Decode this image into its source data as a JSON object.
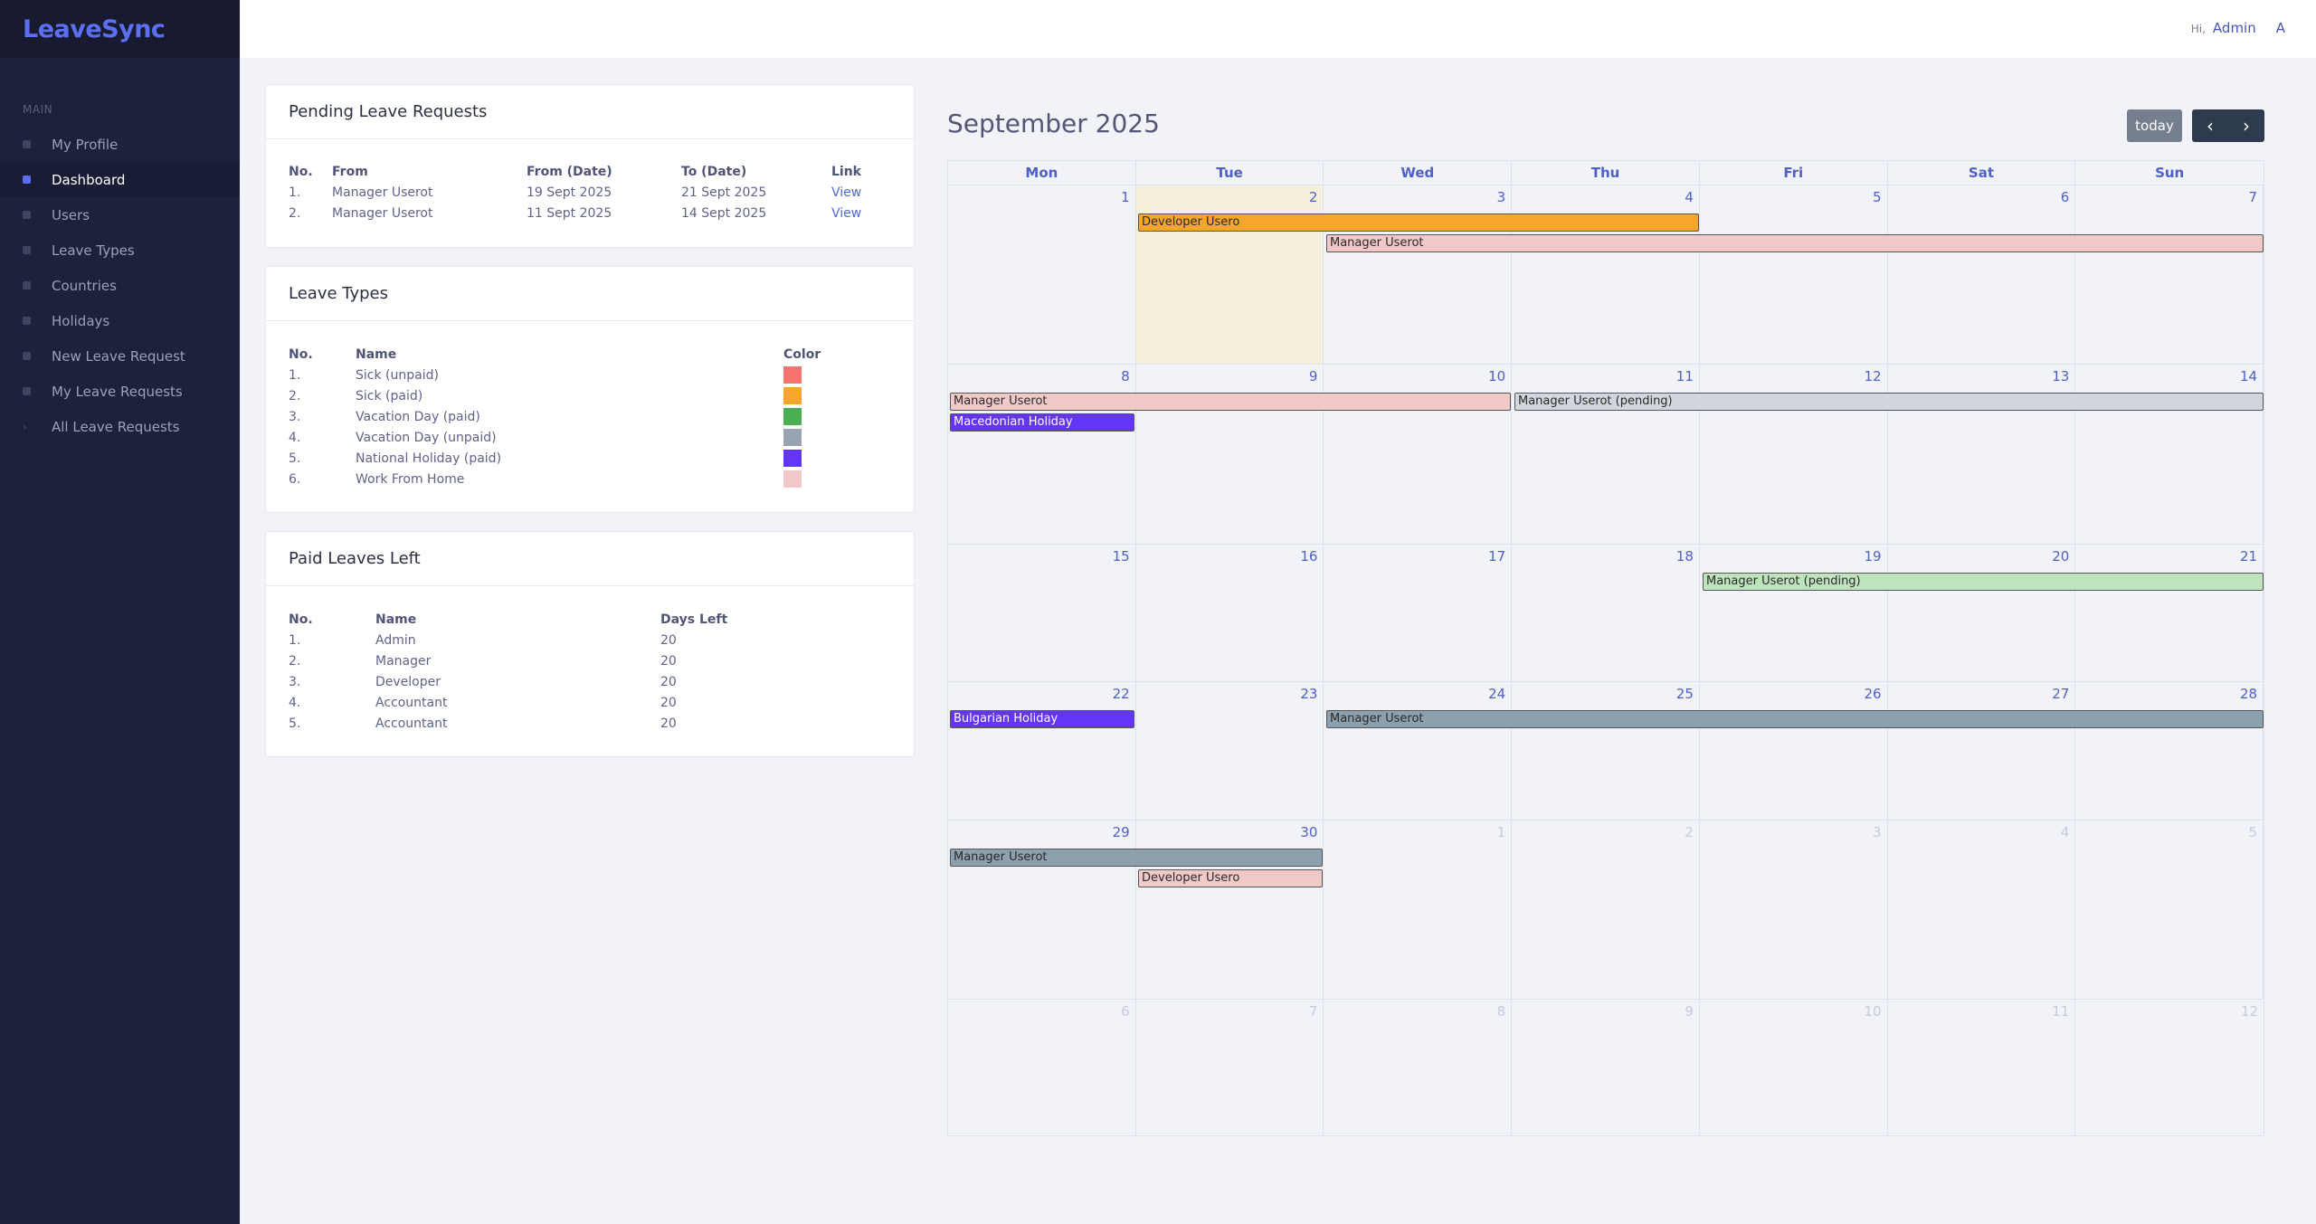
{
  "app": {
    "brand": "LeaveSync"
  },
  "header": {
    "greeting": "Hi,",
    "user_name": "Admin",
    "avatar_letter": "A"
  },
  "sidebar": {
    "section": "MAIN",
    "items": [
      {
        "label": "My Profile",
        "icon": "profile-icon"
      },
      {
        "label": "Dashboard",
        "icon": "dashboard-icon",
        "active": true
      },
      {
        "label": "Users",
        "icon": "users-icon"
      },
      {
        "label": "Leave Types",
        "icon": "leave-types-icon"
      },
      {
        "label": "Countries",
        "icon": "globe-icon"
      },
      {
        "label": "Holidays",
        "icon": "holiday-icon"
      },
      {
        "label": "New Leave Request",
        "icon": "add-icon"
      },
      {
        "label": "My Leave Requests",
        "icon": "document-icon"
      },
      {
        "label": "All Leave Requests",
        "icon": "chevron-right-icon"
      }
    ]
  },
  "pending": {
    "title": "Pending Leave Requests",
    "headers": {
      "no": "No.",
      "from": "From",
      "from_date": "From (Date)",
      "to_date": "To (Date)",
      "link": "Link"
    },
    "rows": [
      {
        "no": "1.",
        "from": "Manager Userot",
        "from_date": "19 Sept 2025",
        "to_date": "21 Sept 2025",
        "link": "View"
      },
      {
        "no": "2.",
        "from": "Manager Userot",
        "from_date": "11 Sept 2025",
        "to_date": "14 Sept 2025",
        "link": "View"
      }
    ]
  },
  "leave_types": {
    "title": "Leave Types",
    "headers": {
      "no": "No.",
      "name": "Name",
      "color": "Color"
    },
    "rows": [
      {
        "no": "1.",
        "name": "Sick (unpaid)",
        "color": "#f4736f"
      },
      {
        "no": "2.",
        "name": "Sick (paid)",
        "color": "#f6a72b"
      },
      {
        "no": "3.",
        "name": "Vacation Day (paid)",
        "color": "#4cae52"
      },
      {
        "no": "4.",
        "name": "Vacation Day (unpaid)",
        "color": "#9aa3b0"
      },
      {
        "no": "5.",
        "name": "National Holiday (paid)",
        "color": "#6335f6"
      },
      {
        "no": "6.",
        "name": "Work From Home",
        "color": "#f2c9c9"
      }
    ]
  },
  "paid_leaves": {
    "title": "Paid Leaves Left",
    "headers": {
      "no": "No.",
      "name": "Name",
      "days": "Days Left"
    },
    "rows": [
      {
        "no": "1.",
        "name": "Admin",
        "days": "20"
      },
      {
        "no": "2.",
        "name": "Manager",
        "days": "20"
      },
      {
        "no": "3.",
        "name": "Developer",
        "days": "20"
      },
      {
        "no": "4.",
        "name": "Accountant",
        "days": "20"
      },
      {
        "no": "5.",
        "name": "Accountant",
        "days": "20"
      }
    ]
  },
  "calendar": {
    "title": "September 2025",
    "today_label": "today",
    "prev_icon": "chevron-left-icon",
    "next_icon": "chevron-right-icon",
    "days_of_week": [
      "Mon",
      "Tue",
      "Wed",
      "Thu",
      "Fri",
      "Sat",
      "Sun"
    ],
    "weeks": [
      {
        "days": [
          "1",
          "2",
          "3",
          "4",
          "5",
          "6",
          "7"
        ],
        "other": [],
        "today": 1
      },
      {
        "days": [
          "8",
          "9",
          "10",
          "11",
          "12",
          "13",
          "14"
        ],
        "other": []
      },
      {
        "days": [
          "15",
          "16",
          "17",
          "18",
          "19",
          "20",
          "21"
        ],
        "other": []
      },
      {
        "days": [
          "22",
          "23",
          "24",
          "25",
          "26",
          "27",
          "28"
        ],
        "other": []
      },
      {
        "days": [
          "29",
          "30",
          "1",
          "2",
          "3",
          "4",
          "5"
        ],
        "other": [
          2,
          3,
          4,
          5,
          6
        ]
      },
      {
        "days": [
          "6",
          "7",
          "8",
          "9",
          "10",
          "11",
          "12"
        ],
        "other": [
          0,
          1,
          2,
          3,
          4,
          5,
          6
        ]
      }
    ],
    "events": [
      {
        "title": "Developer Usero",
        "week": 0,
        "start": 1,
        "end": 3,
        "lane": 0,
        "color": "#f6a72b",
        "holiday": false
      },
      {
        "title": "Manager Userot",
        "week": 0,
        "start": 2,
        "end": 6,
        "lane": 1,
        "color": "#f2c9c9",
        "holiday": false
      },
      {
        "title": "Manager Userot",
        "week": 1,
        "start": 0,
        "end": 2,
        "lane": 0,
        "color": "#f2c9c9",
        "holiday": false
      },
      {
        "title": "Manager Userot (pending)",
        "week": 1,
        "start": 3,
        "end": 6,
        "lane": 0,
        "color": "#d2d6de",
        "holiday": false
      },
      {
        "title": "Macedonian Holiday",
        "week": 1,
        "start": 0,
        "end": 0,
        "lane": 1,
        "color": "#6335f6",
        "holiday": true
      },
      {
        "title": "Manager Userot (pending)",
        "week": 2,
        "start": 4,
        "end": 6,
        "lane": 0,
        "color": "#bfe3bd",
        "holiday": false
      },
      {
        "title": "Bulgarian Holiday",
        "week": 3,
        "start": 0,
        "end": 0,
        "lane": 0,
        "color": "#6335f6",
        "holiday": true
      },
      {
        "title": "Manager Userot",
        "week": 3,
        "start": 2,
        "end": 6,
        "lane": 0,
        "color": "#8da0ad",
        "holiday": false
      },
      {
        "title": "Manager Userot",
        "week": 4,
        "start": 0,
        "end": 1,
        "lane": 0,
        "color": "#8da0ad",
        "holiday": false
      },
      {
        "title": "Developer Usero",
        "week": 4,
        "start": 1,
        "end": 1,
        "lane": 1,
        "color": "#f2c9c9",
        "holiday": false
      }
    ]
  }
}
